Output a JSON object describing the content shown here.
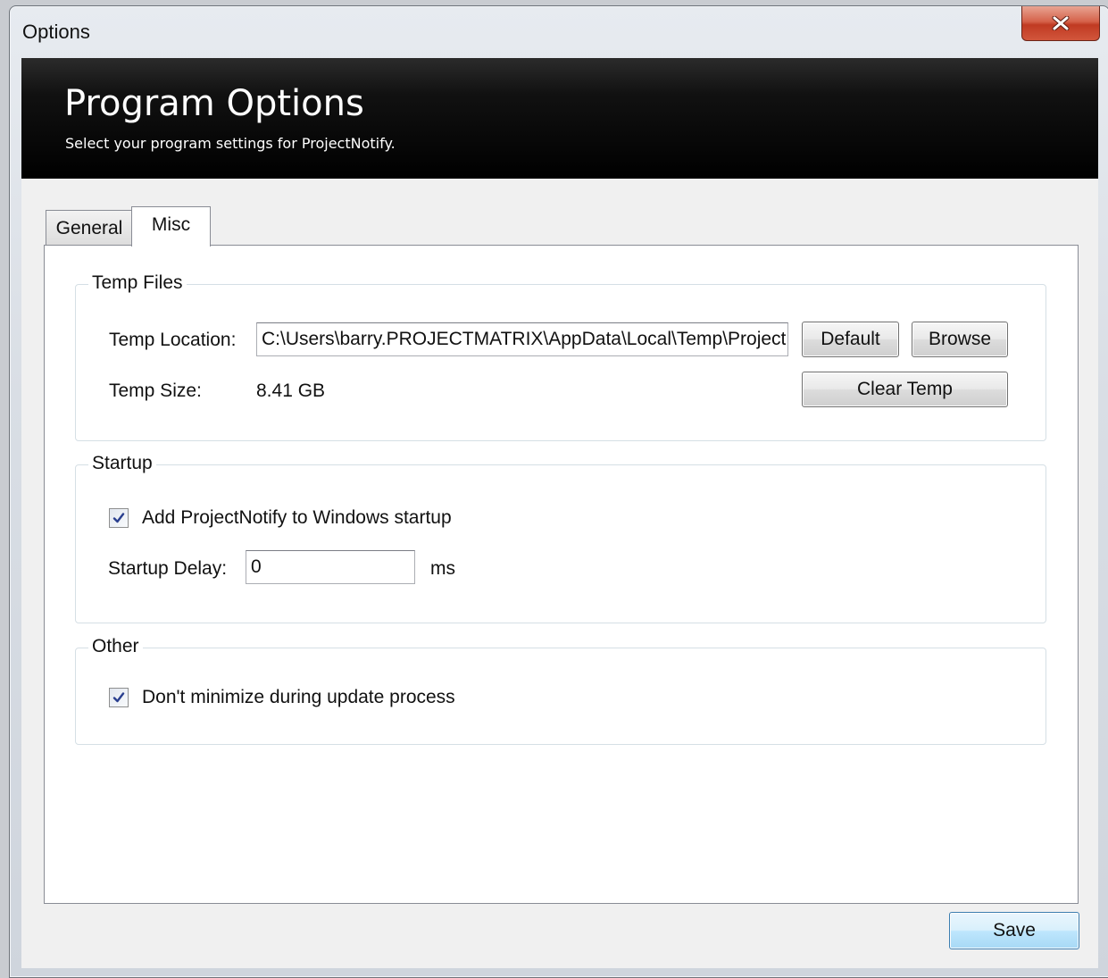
{
  "window": {
    "title": "Options"
  },
  "header": {
    "title": "Program Options",
    "subtitle": "Select your program settings for ProjectNotify."
  },
  "tabs": [
    {
      "label": "General",
      "selected": false
    },
    {
      "label": "Misc",
      "selected": true
    }
  ],
  "temp_files": {
    "group_label": "Temp Files",
    "location_label": "Temp Location:",
    "location_value": "C:\\Users\\barry.PROJECTMATRIX\\AppData\\Local\\Temp\\ProjectNotify",
    "default_button": "Default",
    "browse_button": "Browse",
    "size_label": "Temp Size:",
    "size_value": "8.41 GB",
    "clear_button": "Clear Temp"
  },
  "startup": {
    "group_label": "Startup",
    "add_to_startup_label": "Add ProjectNotify to Windows startup",
    "add_to_startup_checked": true,
    "delay_label": "Startup Delay:",
    "delay_value": "0",
    "delay_unit": "ms"
  },
  "other": {
    "group_label": "Other",
    "dont_minimize_label": "Don't minimize during update process",
    "dont_minimize_checked": true
  },
  "footer": {
    "save_button": "Save"
  },
  "colors": {
    "header_bg": "#000000",
    "close_button": "#c74a33",
    "save_button_border": "#3c7fb1"
  },
  "icons": {
    "close": "close-icon",
    "checkmark": "checkmark-icon"
  }
}
